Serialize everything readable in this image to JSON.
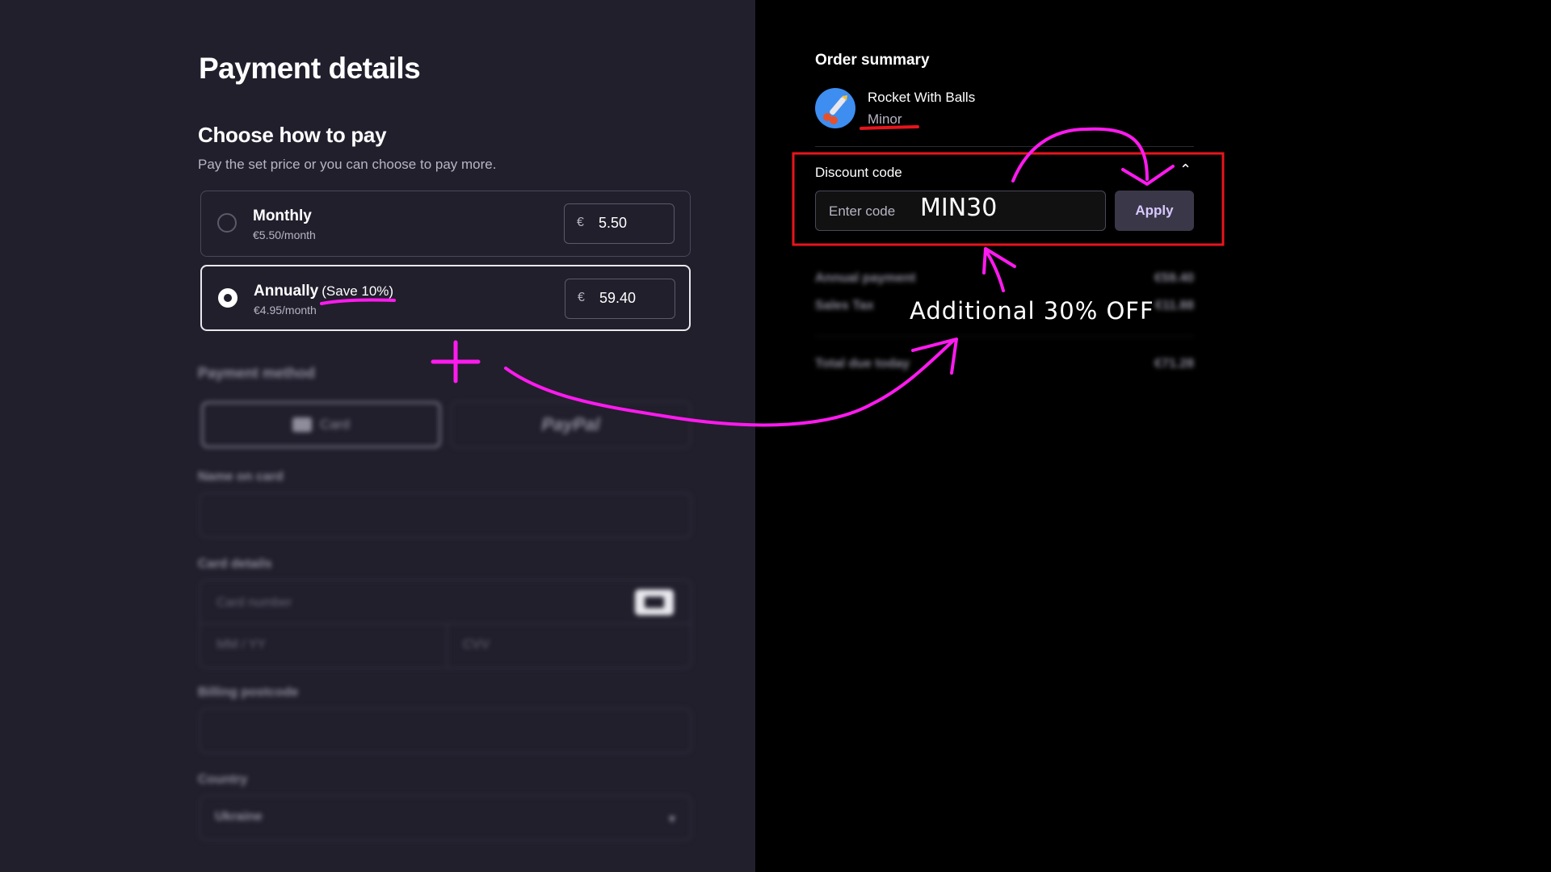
{
  "payment": {
    "title": "Payment details",
    "choose_title": "Choose how to pay",
    "choose_subtitle": "Pay the set price or you can choose to pay more.",
    "plans": [
      {
        "name": "Monthly",
        "save": "",
        "price": "€5.50/month",
        "currency": "€",
        "amount": "5.50",
        "selected": false
      },
      {
        "name": "Annually",
        "save": "(Save 10%)",
        "price": "€4.95/month",
        "currency": "€",
        "amount": "59.40",
        "selected": true
      }
    ],
    "method_title": "Payment method",
    "method_card": "Card",
    "method_paypal": "PayPal",
    "name_label": "Name on card",
    "card_label": "Card details",
    "card_number_ph": "Card number",
    "expiry_ph": "MM / YY",
    "cvv_ph": "CVV",
    "postcode_label": "Billing postcode",
    "country_label": "Country",
    "country_value": "Ukraine"
  },
  "order": {
    "title": "Order summary",
    "product_name": "Rocket With Balls",
    "product_tier": "Minor",
    "discount_label": "Discount code",
    "code_placeholder": "Enter code",
    "code_value": "MIN30",
    "apply_label": "Apply",
    "rows": [
      {
        "label": "Annual payment",
        "value": "€59.40"
      },
      {
        "label": "Sales Tax",
        "value": "€11.88"
      }
    ],
    "total_label": "Total due today",
    "total_value": "€71.28"
  },
  "annotation": {
    "text": "Additional 30% OFF",
    "color": "#ff1aef",
    "box_color": "#e8141c"
  }
}
